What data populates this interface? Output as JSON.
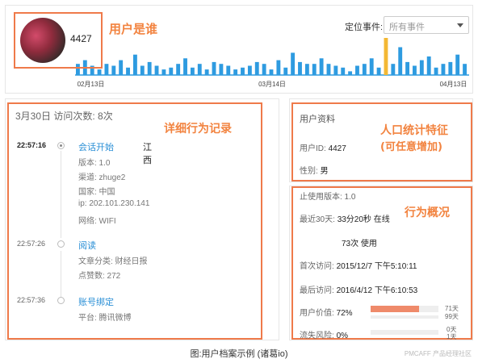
{
  "user": {
    "id_display": "4427"
  },
  "callouts": {
    "who": "用户是谁",
    "detail_log": "详细行为记录",
    "demographics_line1": "人口统计特征",
    "demographics_line2": "(可任意增加)",
    "behavior_overview": "行为概况"
  },
  "filter": {
    "label": "定位事件:",
    "value": "所有事件"
  },
  "timeline": {
    "dates": [
      "02月13日",
      "03月14日",
      "04月13日"
    ],
    "colors": {
      "normal": "#2e9be0",
      "highlight": "#f3b834"
    },
    "bars": [
      0.3,
      0.4,
      0.25,
      0.15,
      0.3,
      0.25,
      0.4,
      0.2,
      0.55,
      0.25,
      0.35,
      0.25,
      0.15,
      0.2,
      0.3,
      0.45,
      0.2,
      0.3,
      0.15,
      0.35,
      0.3,
      0.25,
      0.15,
      0.2,
      0.25,
      0.35,
      0.3,
      0.15,
      0.4,
      0.2,
      0.6,
      0.35,
      0.3,
      0.3,
      0.45,
      0.3,
      0.25,
      0.2,
      0.1,
      0.25,
      0.3,
      0.45,
      0.2,
      1.0,
      0.3,
      0.75,
      0.35,
      0.25,
      0.4,
      0.5,
      0.2,
      0.3,
      0.35,
      0.55,
      0.3
    ],
    "highlight_index": 43
  },
  "visits": {
    "header": "3月30日  访问次数: 8次",
    "events": [
      {
        "time": "22:57:16",
        "title": "会话开始",
        "location": "江西",
        "details": [
          "版本: 1.0",
          "渠道: zhuge2",
          "国家: 中国",
          "ip: 202.101.230.141",
          "网络: WIFI"
        ]
      },
      {
        "time": "22:57:26",
        "title": "阅读",
        "location": "",
        "details": [
          "文章分类: 财经日报",
          "点赞数: 272"
        ]
      },
      {
        "time": "22:57:36",
        "title": "账号绑定",
        "location": "",
        "details": [
          "平台: 腾讯微博"
        ]
      }
    ]
  },
  "profile": {
    "title": "用户资料",
    "id_label": "用户ID:",
    "id_value": "4427",
    "gender_label": "性别:",
    "gender_value": "男"
  },
  "overview": {
    "version": "止使用版本: 1.0",
    "recent_label": "最近30天:",
    "recent_value": "33分20秒 在线",
    "uses": "73次 使用",
    "first_label": "首次访问:",
    "first_value": "2015/12/7 下午5:10:11",
    "last_label": "最后访问:",
    "last_value": "2016/4/12 下午6:10:53",
    "value_label": "用户价值:",
    "value_pct": "72%",
    "value_fraction": 0.72,
    "value_days_a": "71天",
    "value_days_b": "99天",
    "churn_label": "流失风险:",
    "churn_pct": "0%",
    "churn_fraction": 0.0,
    "churn_days_a": "0天",
    "churn_days_b": "1天"
  },
  "caption": "图:用户档案示例 (诸葛io)",
  "watermark": "PMCAFF 产品经理社区"
}
